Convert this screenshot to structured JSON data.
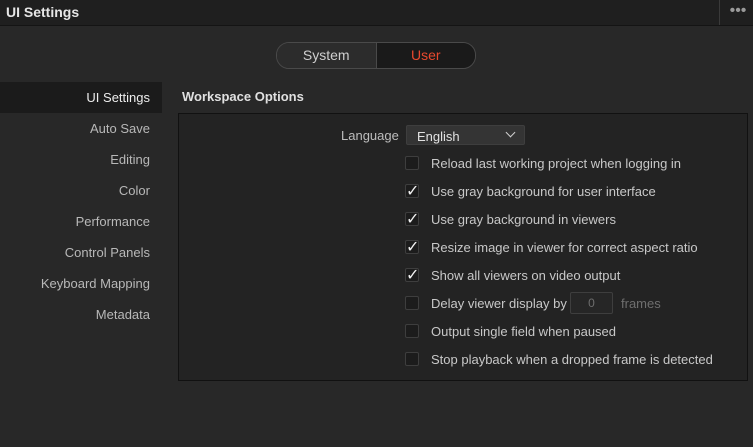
{
  "window": {
    "title": "UI Settings",
    "menu_glyph": "•••"
  },
  "segment": {
    "system_label": "System",
    "user_label": "User",
    "active": "User"
  },
  "sidebar": {
    "items": [
      {
        "label": "UI Settings",
        "active": true
      },
      {
        "label": "Auto Save"
      },
      {
        "label": "Editing"
      },
      {
        "label": "Color"
      },
      {
        "label": "Performance"
      },
      {
        "label": "Control Panels"
      },
      {
        "label": "Keyboard Mapping"
      },
      {
        "label": "Metadata"
      }
    ]
  },
  "workspace": {
    "heading": "Workspace Options",
    "language_label": "Language",
    "language_value": "English",
    "options": [
      {
        "label": "Reload last working project when logging in",
        "checked": false,
        "check_glyph": ""
      },
      {
        "label": "Use gray background for user interface",
        "checked": true,
        "check_glyph": "✓"
      },
      {
        "label": "Use gray background in viewers",
        "checked": true,
        "check_glyph": "✓"
      },
      {
        "label": "Resize image in viewer for correct aspect ratio",
        "checked": true,
        "check_glyph": "✓"
      },
      {
        "label": "Show all viewers on video output",
        "checked": true,
        "check_glyph": "✓"
      },
      {
        "label": "Delay viewer display by",
        "checked": false,
        "check_glyph": "",
        "field_value": "0",
        "unit": "frames"
      },
      {
        "label": "Output single field when paused",
        "checked": false,
        "check_glyph": ""
      },
      {
        "label": "Stop playback when a dropped frame is detected",
        "checked": false,
        "check_glyph": ""
      }
    ]
  },
  "colors": {
    "accent": "#e8492e",
    "background": "#282828",
    "panel": "#232323"
  }
}
